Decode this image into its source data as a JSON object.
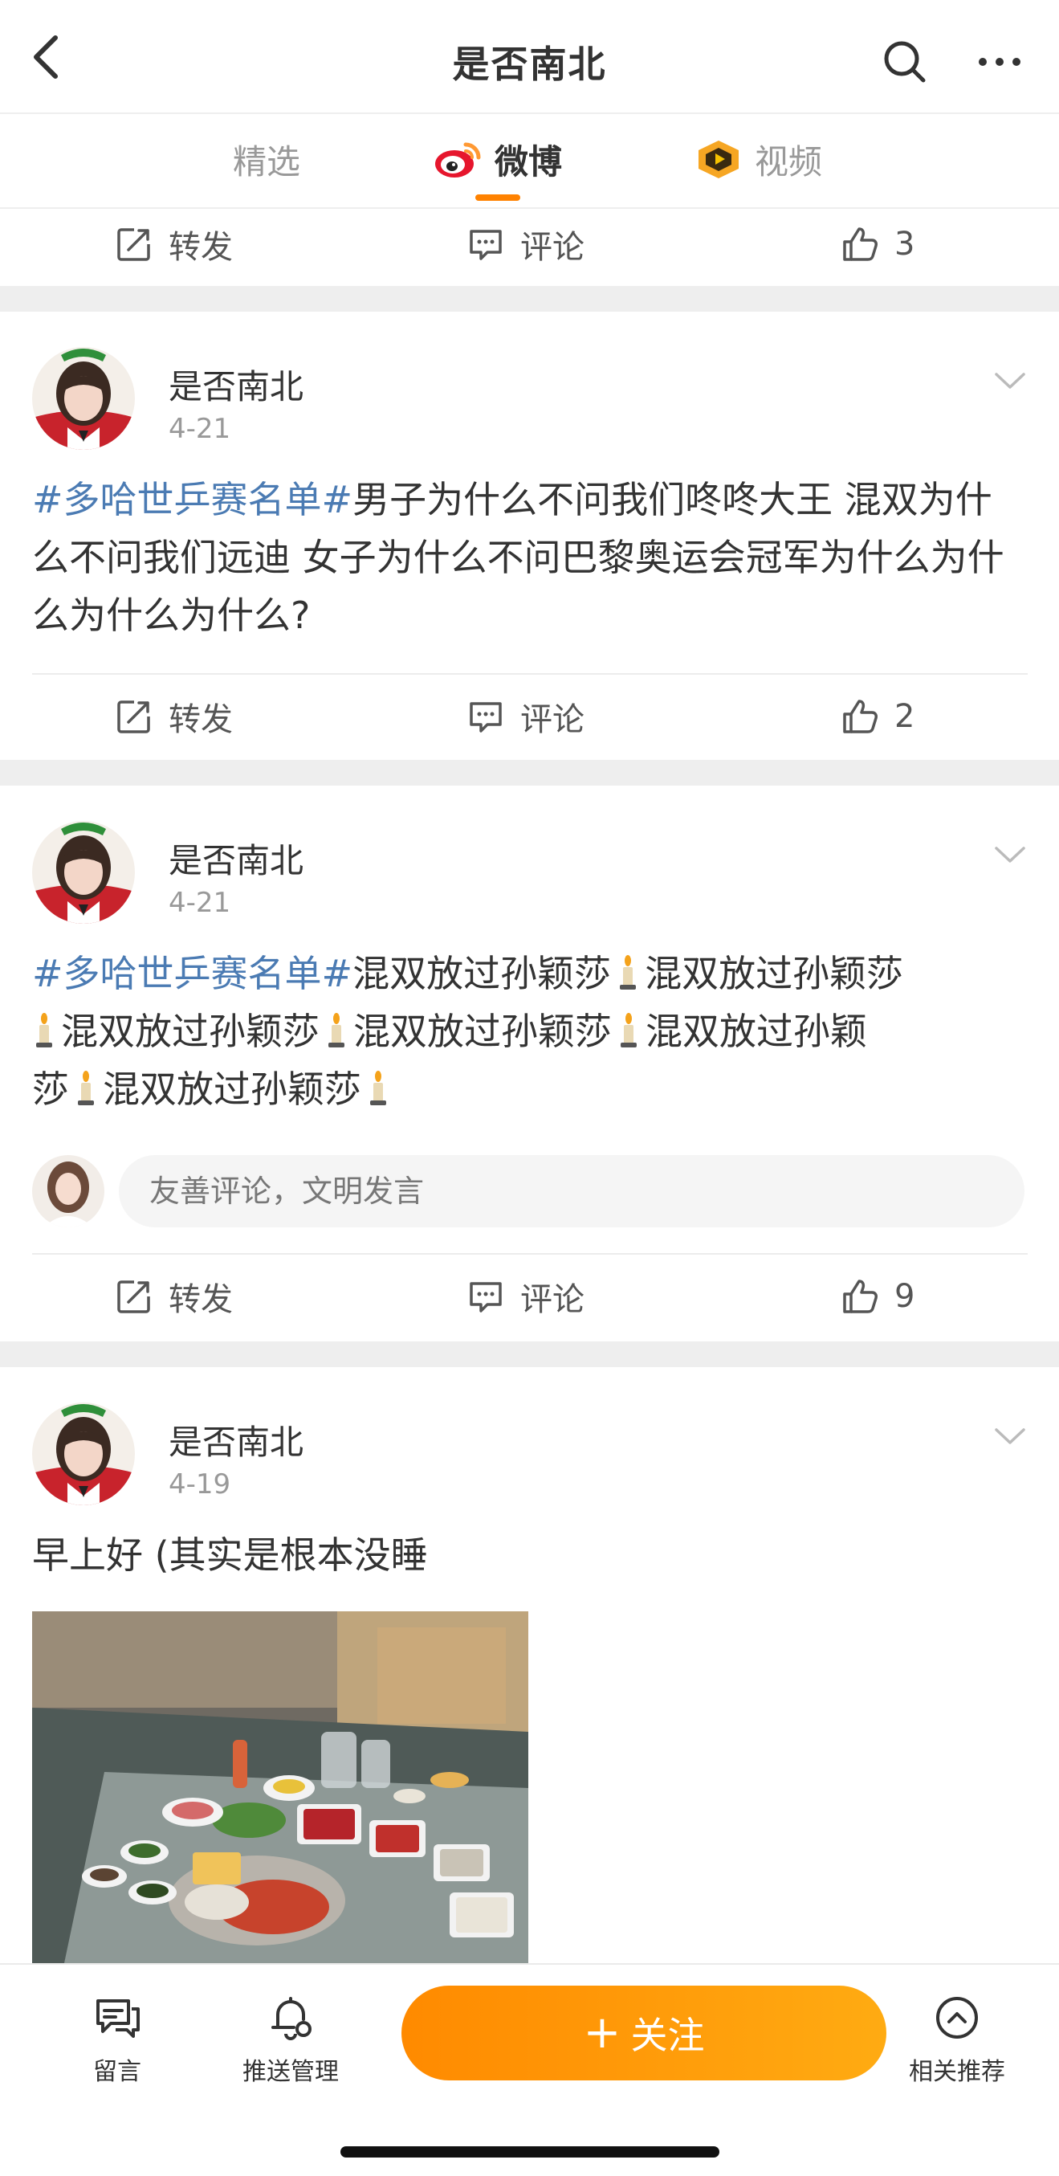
{
  "header": {
    "title": "是否南北"
  },
  "tabs": [
    {
      "label": "精选"
    },
    {
      "label": "微博"
    },
    {
      "label": "视频"
    }
  ],
  "actions": {
    "forward": "转发",
    "comment": "评论"
  },
  "posts": [
    {
      "likes": "3"
    },
    {
      "author": "是否南北",
      "time": "4-21",
      "hashtag": "#多哈世乒赛名单#",
      "text": "男子为什么不问我们咚咚大王 混双为什么不问我们远迪 女子为什么不问巴黎奥运会冠军为什么为什么为什么为什么?",
      "likes": "2"
    },
    {
      "author": "是否南北",
      "time": "4-21",
      "hashtag": "#多哈世乒赛名单#",
      "segments": [
        "混双放过孙颖莎",
        "混双放过孙颖莎",
        "混双放过孙颖莎",
        "混双放过孙颖莎",
        "混双放过孙颖",
        "莎",
        "混双放过孙颖莎"
      ],
      "comment_placeholder": "友善评论，文明发言",
      "likes": "9"
    },
    {
      "author": "是否南北",
      "time": "4-19",
      "text": "早上好 (其实是根本没睡"
    }
  ],
  "bottombar": {
    "message": "留言",
    "push": "推送管理",
    "follow": "关注",
    "recommend": "相关推荐"
  },
  "colors": {
    "accent": "#ff8200",
    "hashtag": "#4b7bb3",
    "gap": "#eeeeee"
  }
}
